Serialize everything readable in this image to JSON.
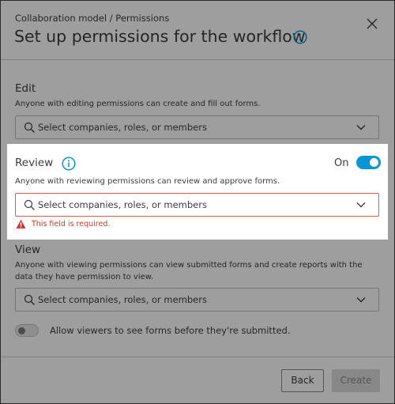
{
  "header": {
    "breadcrumb": "Collaboration model / Permissions",
    "title": "Set up permissions for the workflow",
    "info_icon": "info-icon",
    "close_icon": "close-icon"
  },
  "edit": {
    "label": "Edit",
    "description": "Anyone with editing permissions can create and fill out forms.",
    "placeholder": "Select companies, roles, or members"
  },
  "review": {
    "label": "Review",
    "description": "Anyone with reviewing permissions can review and approve forms.",
    "toggle_label": "On",
    "toggle_state": "on",
    "placeholder": "Select companies, roles, or members",
    "error": "This field is required."
  },
  "view": {
    "label": "View",
    "description": "Anyone with viewing permissions can view submitted forms and create reports with the data they have permission to view.",
    "placeholder": "Select companies, roles, or members",
    "toggle_state": "off",
    "toggle_label": "Allow viewers to see forms before they're submitted."
  },
  "footer": {
    "back_label": "Back",
    "create_label": "Create"
  },
  "colors": {
    "accent": "#0696d7",
    "error": "#d9312b",
    "error_border": "#e2574c",
    "disabled_bg": "#dcdcdc"
  }
}
